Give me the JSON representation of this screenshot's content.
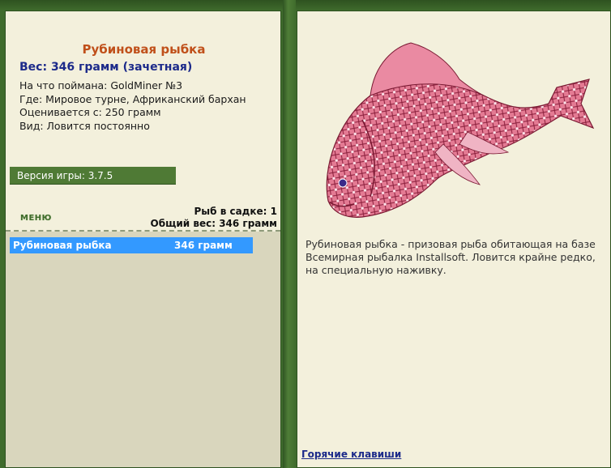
{
  "fish": {
    "name": "Рубиновая рыбка",
    "weight_line": "Вес: 346 грамм (зачетная)",
    "caught_on": "На что поймана: GoldMiner №3",
    "where": "Где: Мировое турне, Африканский бархан",
    "valued_from": "Оценивается с: 250 грамм",
    "kind": "Вид: Ловится постоянно",
    "description": "Рубиновая рыбка - призовая рыба обитающая на базе Всемирная рыбалка Installsoft. Ловится крайне редко, на специальную наживку."
  },
  "version": "Версия игры: 3.7.5",
  "menu_label": "МЕНЮ",
  "stats": {
    "fish_in_keepnet": "Рыб в садке: 1",
    "total_weight": "Общий вес: 346 грамм"
  },
  "catch_list": [
    {
      "name": "Рубиновая рыбка",
      "weight": "346 грамм"
    }
  ],
  "hotkeys_link": "Горячие клавиши",
  "colors": {
    "frame_green": "#3f6b2c",
    "panel_bg": "#f3f0dc",
    "title_orange": "#c0501a",
    "weight_blue": "#1c2a8a",
    "selection_blue": "#3399ff",
    "list_bg": "#d9d6bd",
    "fish_red": "#d85a78"
  }
}
